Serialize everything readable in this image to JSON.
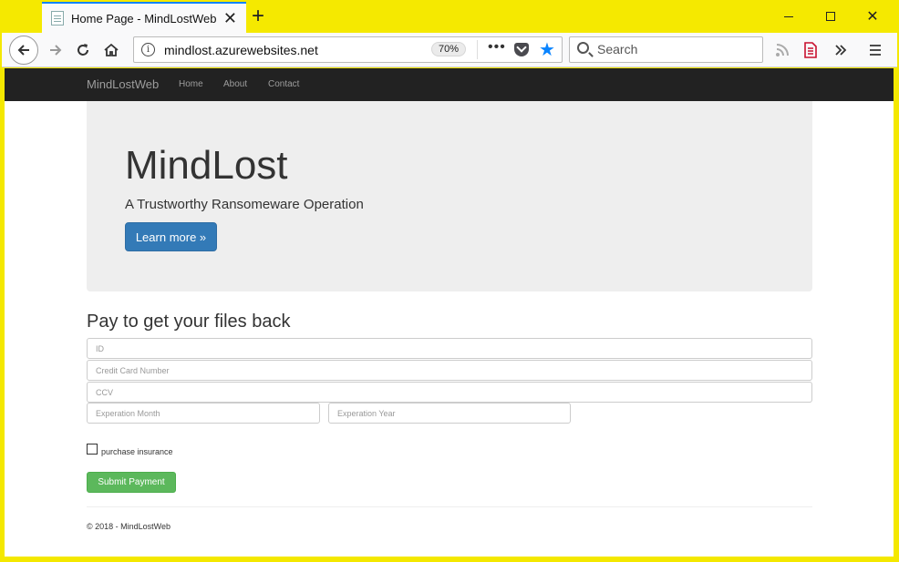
{
  "browser": {
    "tab_title": "Home Page - MindLostWeb",
    "url": "mindlost.azurewebsites.net",
    "zoom": "70%",
    "search_placeholder": "Search"
  },
  "site": {
    "brand": "MindLostWeb",
    "nav": [
      "Home",
      "About",
      "Contact"
    ],
    "hero_title": "MindLost",
    "hero_lead": "A Trustworthy Ransomeware Operation",
    "hero_button": "Learn more »",
    "form_heading": "Pay to get your files back",
    "fields": {
      "id": "ID",
      "card": "Credit Card Number",
      "ccv": "CCV",
      "month": "Experation Month",
      "year": "Experation Year"
    },
    "insurance_label": "purchase insurance",
    "insurance_checked": false,
    "submit_label": "Submit Payment",
    "footer": "© 2018 - MindLostWeb"
  },
  "colors": {
    "titlebar": "#f5e900",
    "site_nav": "#222222",
    "primary_button": "#337ab7",
    "success_button": "#5cb85c",
    "bookmark_star": "#0a84ff"
  }
}
